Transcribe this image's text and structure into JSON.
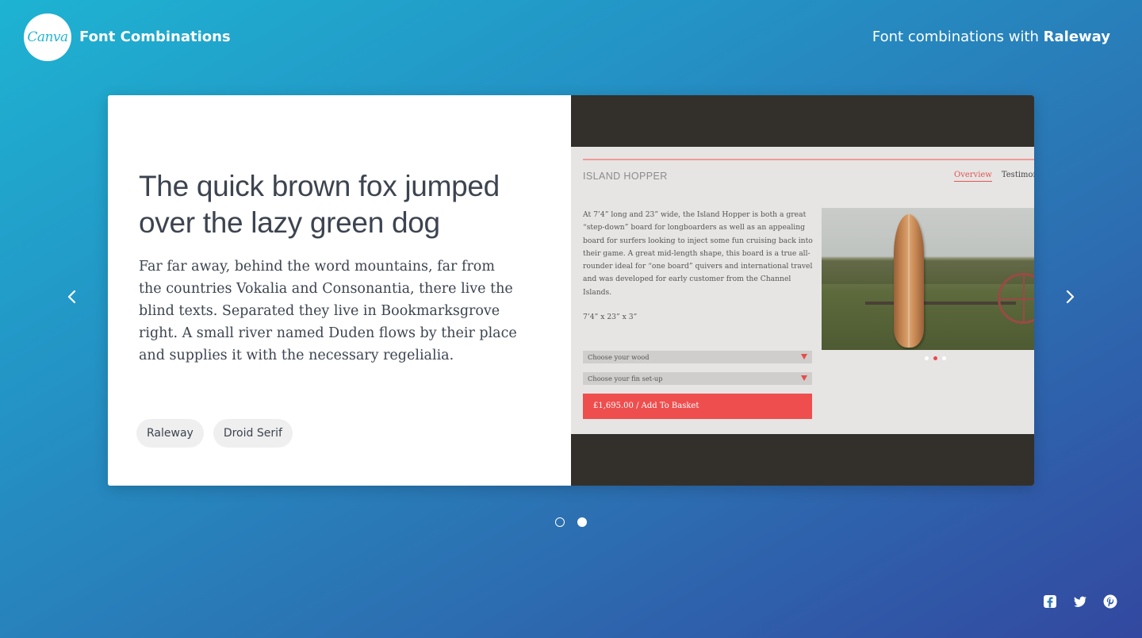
{
  "header": {
    "logo_text": "Canva",
    "app_title": "Font Combinations",
    "combo_prefix": "Font combinations with",
    "combo_font": "Raleway"
  },
  "slide": {
    "heading": "The quick brown fox jumped over the lazy green dog",
    "body": "Far far away, behind the word mountains, far from the countries Vokalia and Consonantia, there live the blind texts. Separated they live in Bookmarksgrove right. A small river named Duden flows by their place and supplies it with the necessary regelialia.",
    "fonts": [
      "Raleway",
      "Droid Serif"
    ]
  },
  "preview": {
    "brand": "ISLAND HOPPER",
    "nav": [
      "Overview",
      "Testimon"
    ],
    "description": "At 7’4” long and 23” wide, the Island Hopper is both a great “step-down” board for longboarders as well as an appealing board for surfers looking to inject some fun cruising back into their game. A great mid-length shape, this board is a true all-rounder ideal for “one board” quivers and international travel and was developed for early customer from the Channel Islands.",
    "size": "7’4” x 23” x 3”",
    "select_wood": "Choose your wood",
    "select_fin": "Choose your fin set-up",
    "button_label": "£1,695.00  /  Add To Basket",
    "photo_dots": 3,
    "photo_dot_active": 2
  },
  "pager": {
    "count": 2,
    "active": 2
  },
  "social": [
    "facebook-icon",
    "twitter-icon",
    "pinterest-icon"
  ],
  "colors": {
    "accent": "#ee4e4e",
    "text_dark": "#3d4450",
    "chip_bg": "#efefef",
    "preview_dark": "#33302b"
  }
}
